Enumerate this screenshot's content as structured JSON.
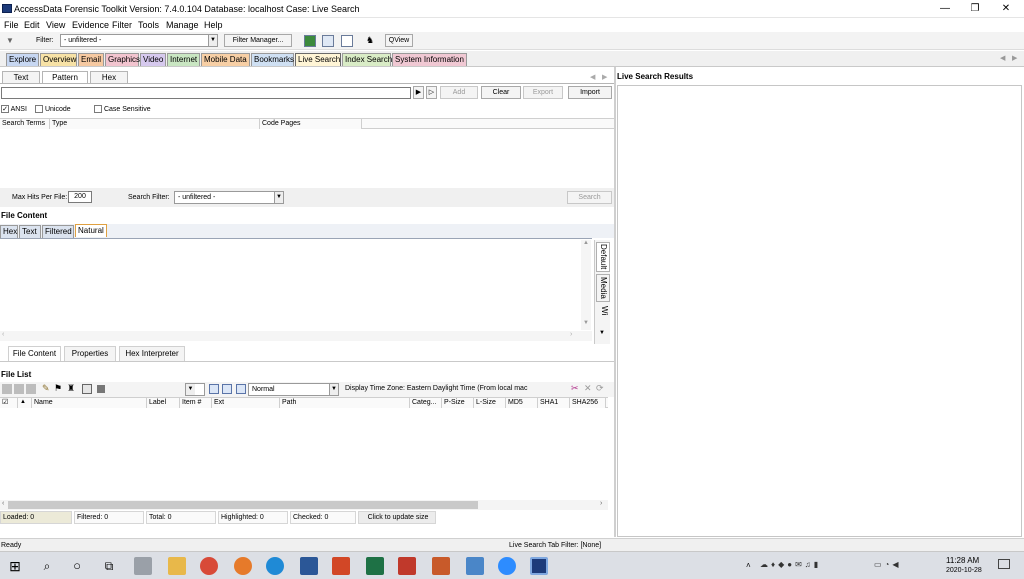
{
  "window": {
    "title": "AccessData Forensic Toolkit Version: 7.4.0.104 Database: localhost Case: Live Search",
    "controls": {
      "minimize": "—",
      "maximize": "❐",
      "close": "✕"
    }
  },
  "menu": [
    "File",
    "Edit",
    "View",
    "Evidence",
    "Filter",
    "Tools",
    "Manage",
    "Help"
  ],
  "toolbar": {
    "filter_label": "Filter:",
    "filter_value": "- unfiltered -",
    "filter_manager": "Filter Manager...",
    "qview": "QView"
  },
  "tabs": [
    {
      "label": "Explore",
      "color": "#c7d7f2"
    },
    {
      "label": "Overview",
      "color": "#f7e2a6"
    },
    {
      "label": "Email",
      "color": "#f6c9a1"
    },
    {
      "label": "Graphics",
      "color": "#f2c4cf"
    },
    {
      "label": "Video",
      "color": "#d6c9ee"
    },
    {
      "label": "Internet",
      "color": "#c9e6c2"
    },
    {
      "label": "Mobile Data",
      "color": "#f7cfa5"
    },
    {
      "label": "Bookmarks",
      "color": "#cfe0f3"
    },
    {
      "label": "Live Search",
      "color": "#fff5d6"
    },
    {
      "label": "Index Search",
      "color": "#d9ecc6"
    },
    {
      "label": "System Information",
      "color": "#f0c8d3"
    }
  ],
  "search": {
    "subtabs": [
      "Text",
      "Pattern",
      "Hex"
    ],
    "add": "Add",
    "clear": "Clear",
    "export": "Export",
    "import": "Import",
    "ansi": "ANSI",
    "unicode": "Unicode",
    "case_sensitive": "Case Sensitive",
    "columns": [
      "Search Terms",
      "Type",
      "Code Pages"
    ],
    "max_hits_label": "Max Hits Per File:",
    "max_hits_value": "200",
    "search_filter_label": "Search Filter:",
    "search_filter_value": "- unfiltered -",
    "search_button": "Search"
  },
  "file_content": {
    "heading": "File Content",
    "view_tabs": [
      "Hex",
      "Text",
      "Filtered",
      "Natural"
    ],
    "side_tabs": [
      "Default",
      "Media",
      "Wi"
    ],
    "bottom_tabs": [
      "File Content",
      "Properties",
      "Hex Interpreter"
    ]
  },
  "file_list": {
    "heading": "File List",
    "view_mode": "Normal",
    "time_zone": "Display Time Zone: Eastern Daylight Time  (From local mac",
    "columns": [
      "Name",
      "Label",
      "Item #",
      "Ext",
      "Path",
      "Categ...",
      "P-Size",
      "L-Size",
      "MD5",
      "SHA1",
      "SHA256"
    ]
  },
  "stats": {
    "loaded": "Loaded: 0",
    "filtered": "Filtered: 0",
    "total": "Total: 0",
    "highlighted": "Highlighted: 0",
    "checked": "Checked: 0",
    "update": "Click to update size"
  },
  "right_pane": {
    "title": "Live Search Results"
  },
  "status": {
    "left": "Ready",
    "filter": "Live Search Tab Filter: [None]"
  },
  "taskbar": {
    "time": "11:28 AM",
    "date": "2020-10-28"
  }
}
